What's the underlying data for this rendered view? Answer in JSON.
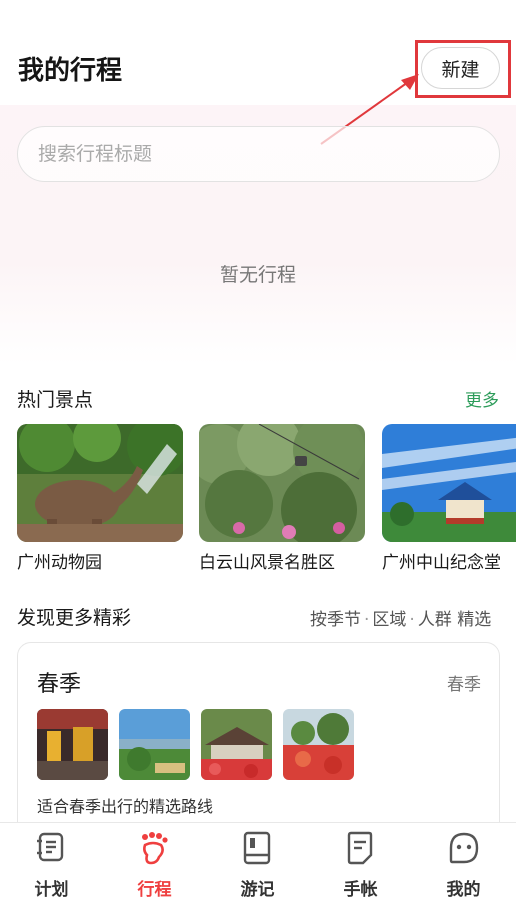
{
  "header": {
    "title": "我的行程",
    "new_button": "新建"
  },
  "search": {
    "placeholder": "搜索行程标题"
  },
  "empty_state": "暂无行程",
  "hot_spots": {
    "title": "热门景点",
    "more": "更多",
    "items": [
      {
        "name": "广州动物园"
      },
      {
        "name": "白云山风景名胜区"
      },
      {
        "name": "广州中山纪念堂"
      }
    ]
  },
  "discover": {
    "title": "发现更多精彩",
    "filters": [
      "按季节",
      "区域",
      "人群",
      "精选"
    ]
  },
  "season_card": {
    "title": "春季",
    "tag": "春季",
    "description": "适合春季出行的精选路线"
  },
  "tabbar": {
    "items": [
      {
        "label": "计划",
        "icon": "plan-icon",
        "active": false
      },
      {
        "label": "行程",
        "icon": "footprint-icon",
        "active": true
      },
      {
        "label": "游记",
        "icon": "book-icon",
        "active": false
      },
      {
        "label": "手帐",
        "icon": "note-icon",
        "active": false
      },
      {
        "label": "我的",
        "icon": "profile-face-icon",
        "active": false
      }
    ]
  },
  "colors": {
    "accent_red": "#ef3f3f",
    "link_green": "#2d9c5a",
    "annotation_red": "#e0383c",
    "header_bg_pink": "#fdf4f7"
  }
}
